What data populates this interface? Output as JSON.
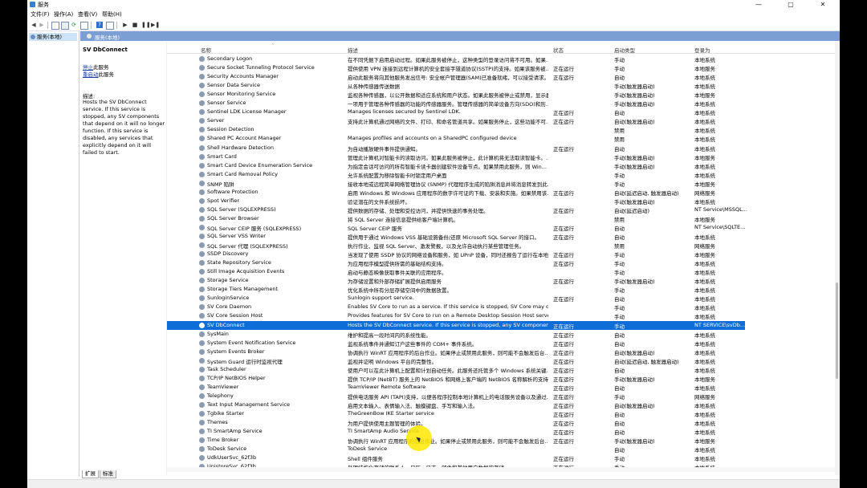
{
  "window": {
    "title": "服务",
    "controls": [
      "—",
      "▢",
      "✕"
    ]
  },
  "menu": [
    "文件(F)",
    "操作(A)",
    "查看(V)",
    "帮助(H)"
  ],
  "toolbar_icons": [
    "back-icon",
    "forward-icon",
    "console-tree-icon",
    "properties-icon",
    "refresh-icon",
    "export-icon",
    "help-icon",
    "view-icon",
    "play-icon",
    "stop-icon",
    "pause-icon",
    "restart-icon"
  ],
  "tree": {
    "root_label": "服务(本地)"
  },
  "pane": {
    "header_label": "服务(本地)"
  },
  "details": {
    "service_title": "SV DbConnect",
    "stop_link": "停止",
    "stop_suffix": "此服务",
    "restart_link": "重启动",
    "restart_suffix": "此服务",
    "desc_label": "描述:",
    "desc_text": "Hosts the SV DbConnect service. If this service is stopped, any SV components that depend on it will no longer function. If this service is disabled, any services that explicitly depend on it will failed to start."
  },
  "columns": {
    "name": "名称",
    "desc": "描述",
    "status": "状态",
    "start": "启动类型",
    "logon": "登录为"
  },
  "rows": [
    {
      "name": "Secondary Logon",
      "desc": "在不同凭据下启用启动过程。如果此服务被停止，这种类型的登录访问将不可用。如果...",
      "status": "",
      "start": "手动",
      "logon": "本地系统"
    },
    {
      "name": "Secure Socket Tunneling Protocol Service",
      "desc": "提供使用 VPN 连接到远程计算机的安全套接字隧道协议(SSTP)的支持。如果该服务被...",
      "status": "正在运行",
      "start": "手动",
      "logon": "本地服务"
    },
    {
      "name": "Security Accounts Manager",
      "desc": "启动此服务将向其他服务发出信号: 安全帐户管理器(SAM)已准备就绪，可以接受请求。...",
      "status": "正在运行",
      "start": "自动",
      "logon": "本地系统"
    },
    {
      "name": "Sensor Data Service",
      "desc": "从各种传感器传送数据",
      "status": "",
      "start": "手动(触发器启动)",
      "logon": "本地系统"
    },
    {
      "name": "Sensor Monitoring Service",
      "desc": "监视各种传感器，以公开数据和适应系统和用户状态。如果此服务被停止或禁用，显示器...",
      "status": "",
      "start": "手动(触发器启动)",
      "logon": "本地服务"
    },
    {
      "name": "Sensor Service",
      "desc": "一项用于管理各种传感器的功能的传感器服务。管理传感器的简单设备方向(SDO)和历...",
      "status": "",
      "start": "手动(触发器启动)",
      "logon": "本地系统"
    },
    {
      "name": "Sentinel LDK License Manager",
      "desc": "Manages licenses secured by Sentinel LDK.",
      "status": "正在运行",
      "start": "自动",
      "logon": "本地系统"
    },
    {
      "name": "Server",
      "desc": "支持此计算机通过网络的文件、打印、和命名管道共享。如果服务停止，这些功能不可...",
      "status": "正在运行",
      "start": "自动(触发器启动)",
      "logon": "本地系统"
    },
    {
      "name": "Session Detection",
      "desc": "",
      "status": "",
      "start": "禁用",
      "logon": "本地系统"
    },
    {
      "name": "Shared PC Account Manager",
      "desc": "Manages profiles and accounts on a SharedPC configured device",
      "status": "",
      "start": "禁用",
      "logon": "本地系统"
    },
    {
      "name": "Shell Hardware Detection",
      "desc": "为自动播放硬件事件提供通知。",
      "status": "正在运行",
      "start": "自动",
      "logon": "本地系统"
    },
    {
      "name": "Smart Card",
      "desc": "管理此计算机对智能卡的读取访问。如果此服务被停止，此计算机将无法取读智能卡。...",
      "status": "",
      "start": "手动(触发器启动)",
      "logon": "本地服务"
    },
    {
      "name": "Smart Card Device Enumeration Service",
      "desc": "为指定会话可访问的所有智能卡读卡器创建软件设备节点。如果禁用此服务，则 Win...",
      "status": "",
      "start": "手动(触发器启动)",
      "logon": "本地系统"
    },
    {
      "name": "Smart Card Removal Policy",
      "desc": "允许系统配置为移除智能卡时锁定用户桌面",
      "status": "",
      "start": "手动",
      "logon": "本地系统"
    },
    {
      "name": "SNMP 陷阱",
      "desc": "接收本地或远程简单网络管理协议 (SNMP) 代理程序生成的陷阱消息并将消息转发到此...",
      "status": "",
      "start": "手动",
      "logon": "本地服务"
    },
    {
      "name": "Software Protection",
      "desc": "启用 Windows 和 Windows 应用程序的数字许可证的下载、安装和实施。如果禁用该...",
      "status": "正在运行",
      "start": "自动(延迟启动, 触发器启动)",
      "logon": "网络服务"
    },
    {
      "name": "Spot Verifier",
      "desc": "验证潜在的文件系统损坏。",
      "status": "",
      "start": "手动(触发器启动)",
      "logon": "本地系统"
    },
    {
      "name": "SQL Server (SQLEXPRESS)",
      "desc": "提供数据的存储、处理和受控访问，并提供快速的事务处理。",
      "status": "正在运行",
      "start": "自动(延迟启动)",
      "logon": "NT Service\\MSSQL..."
    },
    {
      "name": "SQL Server Browser",
      "desc": "将 SQL Server 连接信息提供给客户端计算机。",
      "status": "",
      "start": "禁用",
      "logon": "本地服务"
    },
    {
      "name": "SQL Server CEIP 服务 (SQLEXPRESS)",
      "desc": "SQL Server CEIP 服务",
      "status": "正在运行",
      "start": "自动",
      "logon": "NT Service\\SQLTE..."
    },
    {
      "name": "SQL Server VSS Writer",
      "desc": "提供用于通过 Windows VSS 基础设施备份/还原 Microsoft SQL Server 的接口。",
      "status": "正在运行",
      "start": "自动",
      "logon": "本地系统"
    },
    {
      "name": "SQL Server 代理 (SQLEXPRESS)",
      "desc": "执行作业、监视 SQL Server、激发警报，以及允许自动执行某些管理任务。",
      "status": "",
      "start": "禁用",
      "logon": "网络服务"
    },
    {
      "name": "SSDP Discovery",
      "desc": "当发现了使用 SSDP 协议的网络设备和服务，如 UPnP 设备，同时还报告了运行在本地...",
      "status": "正在运行",
      "start": "手动",
      "logon": "本地服务"
    },
    {
      "name": "State Repository Service",
      "desc": "为应用程序模型提供所需的基础结构支持。",
      "status": "正在运行",
      "start": "手动",
      "logon": "本地系统"
    },
    {
      "name": "Still Image Acquisition Events",
      "desc": "启动与静态映像获取事件关联的应用程序。",
      "status": "",
      "start": "手动",
      "logon": "本地系统"
    },
    {
      "name": "Storage Service",
      "desc": "为存储设置和外部存储扩展提供启用服务",
      "status": "正在运行",
      "start": "手动(触发器启动)",
      "logon": "本地系统"
    },
    {
      "name": "Storage Tiers Management",
      "desc": "优化系统中所有分层存储空间中的数据放置。",
      "status": "",
      "start": "手动",
      "logon": "本地系统"
    },
    {
      "name": "SunloginService",
      "desc": "Sunlogin support service.",
      "status": "正在运行",
      "start": "自动",
      "logon": "本地系统"
    },
    {
      "name": "SV Core Daemon",
      "desc": "Enables SV Core to run as a service. If this service is stopped, SV Core may onl...",
      "status": "",
      "start": "手动",
      "logon": "本地系统"
    },
    {
      "name": "SV Core Session Host",
      "desc": "Provides features for SV Core to run on a Remote Desktop Session Host server....",
      "status": "",
      "start": "手动",
      "logon": "本地系统"
    },
    {
      "name": "SV DbConnect",
      "desc": "Hosts the SV DbConnect service. If this service is stopped, any SV components ...",
      "status": "正在运行",
      "start": "手动",
      "logon": "NT SERVICE\\svDb...",
      "selected": true
    },
    {
      "name": "SysMain",
      "desc": "维护和提高一段时间内的系统性能。",
      "status": "正在运行",
      "start": "自动",
      "logon": "本地系统"
    },
    {
      "name": "System Event Notification Service",
      "desc": "监视系统事件并通知订户这些事件的 COM+ 事件系统。",
      "status": "正在运行",
      "start": "自动",
      "logon": "本地系统"
    },
    {
      "name": "System Events Broker",
      "desc": "协调执行 WinRT 应用程序的后台作业。如果停止或禁用此服务，则可能不会触发后台...",
      "status": "正在运行",
      "start": "自动(触发器启动)",
      "logon": "本地系统"
    },
    {
      "name": "System Guard 运行时监视代理",
      "desc": "监视并证明 Windows 平台的完整性。",
      "status": "正在运行",
      "start": "自动(延迟启动, 触发器启动)",
      "logon": "本地系统"
    },
    {
      "name": "Task Scheduler",
      "desc": "使用户可以在此计算机上配置和计划自动任务。此服务还托管多个 Windows 系统关键...",
      "status": "正在运行",
      "start": "自动",
      "logon": "本地系统"
    },
    {
      "name": "TCP/IP NetBIOS Helper",
      "desc": "提供 TCP/IP (NetBT) 服务上的 NetBIOS 和网络上客户端的 NetBIOS 名称解析的支持...",
      "status": "正在运行",
      "start": "手动(触发器启动)",
      "logon": "本地服务"
    },
    {
      "name": "TeamViewer",
      "desc": "TeamViewer Remote Software",
      "status": "正在运行",
      "start": "自动",
      "logon": "本地系统"
    },
    {
      "name": "Telephony",
      "desc": "提供电话服务 API (TAPI)支持，以便各程序控制本地计算机上的电话服务设备以及通过...",
      "status": "正在运行",
      "start": "手动",
      "logon": "网络服务"
    },
    {
      "name": "Text Input Management Service",
      "desc": "启用文本输入、表情输入法、触摸键盘、手写和输入法。",
      "status": "正在运行",
      "start": "自动(触发器启动)",
      "logon": "本地系统"
    },
    {
      "name": "Tgbike Starter",
      "desc": "TheGreenBow IKE Starter service",
      "status": "正在运行",
      "start": "自动",
      "logon": "本地系统"
    },
    {
      "name": "Themes",
      "desc": "为用户提供使用主题管理的体验。",
      "status": "正在运行",
      "start": "自动",
      "logon": "本地系统"
    },
    {
      "name": "TI SmartAmp Service",
      "desc": "TI SmartAmp Audio Service",
      "status": "正在运行",
      "start": "自动",
      "logon": "本地系统"
    },
    {
      "name": "Time Broker",
      "desc": "协调执行 WinRT 应用程序的后台作业。如果停止或禁用此服务，则可能不会触发后台...",
      "status": "正在运行",
      "start": "手动(触发器启动)",
      "logon": "本地服务"
    },
    {
      "name": "ToDesk Service",
      "desc": "ToDesk Service",
      "status": "",
      "start": "自动",
      "logon": "本地系统"
    },
    {
      "name": "UdkUserSvc_62f3b",
      "desc": "Shell 组件服务",
      "status": "正在运行",
      "start": "手动",
      "logon": "本地系统"
    },
    {
      "name": "UnistoreSvc_62f3b",
      "desc": "处理结构化存储的联系人、日历、日志、邮件和其他用户数据的存储...",
      "status": "正在运行",
      "start": "手动",
      "logon": "本地系统"
    }
  ],
  "tabs": [
    "扩展",
    "标准"
  ]
}
